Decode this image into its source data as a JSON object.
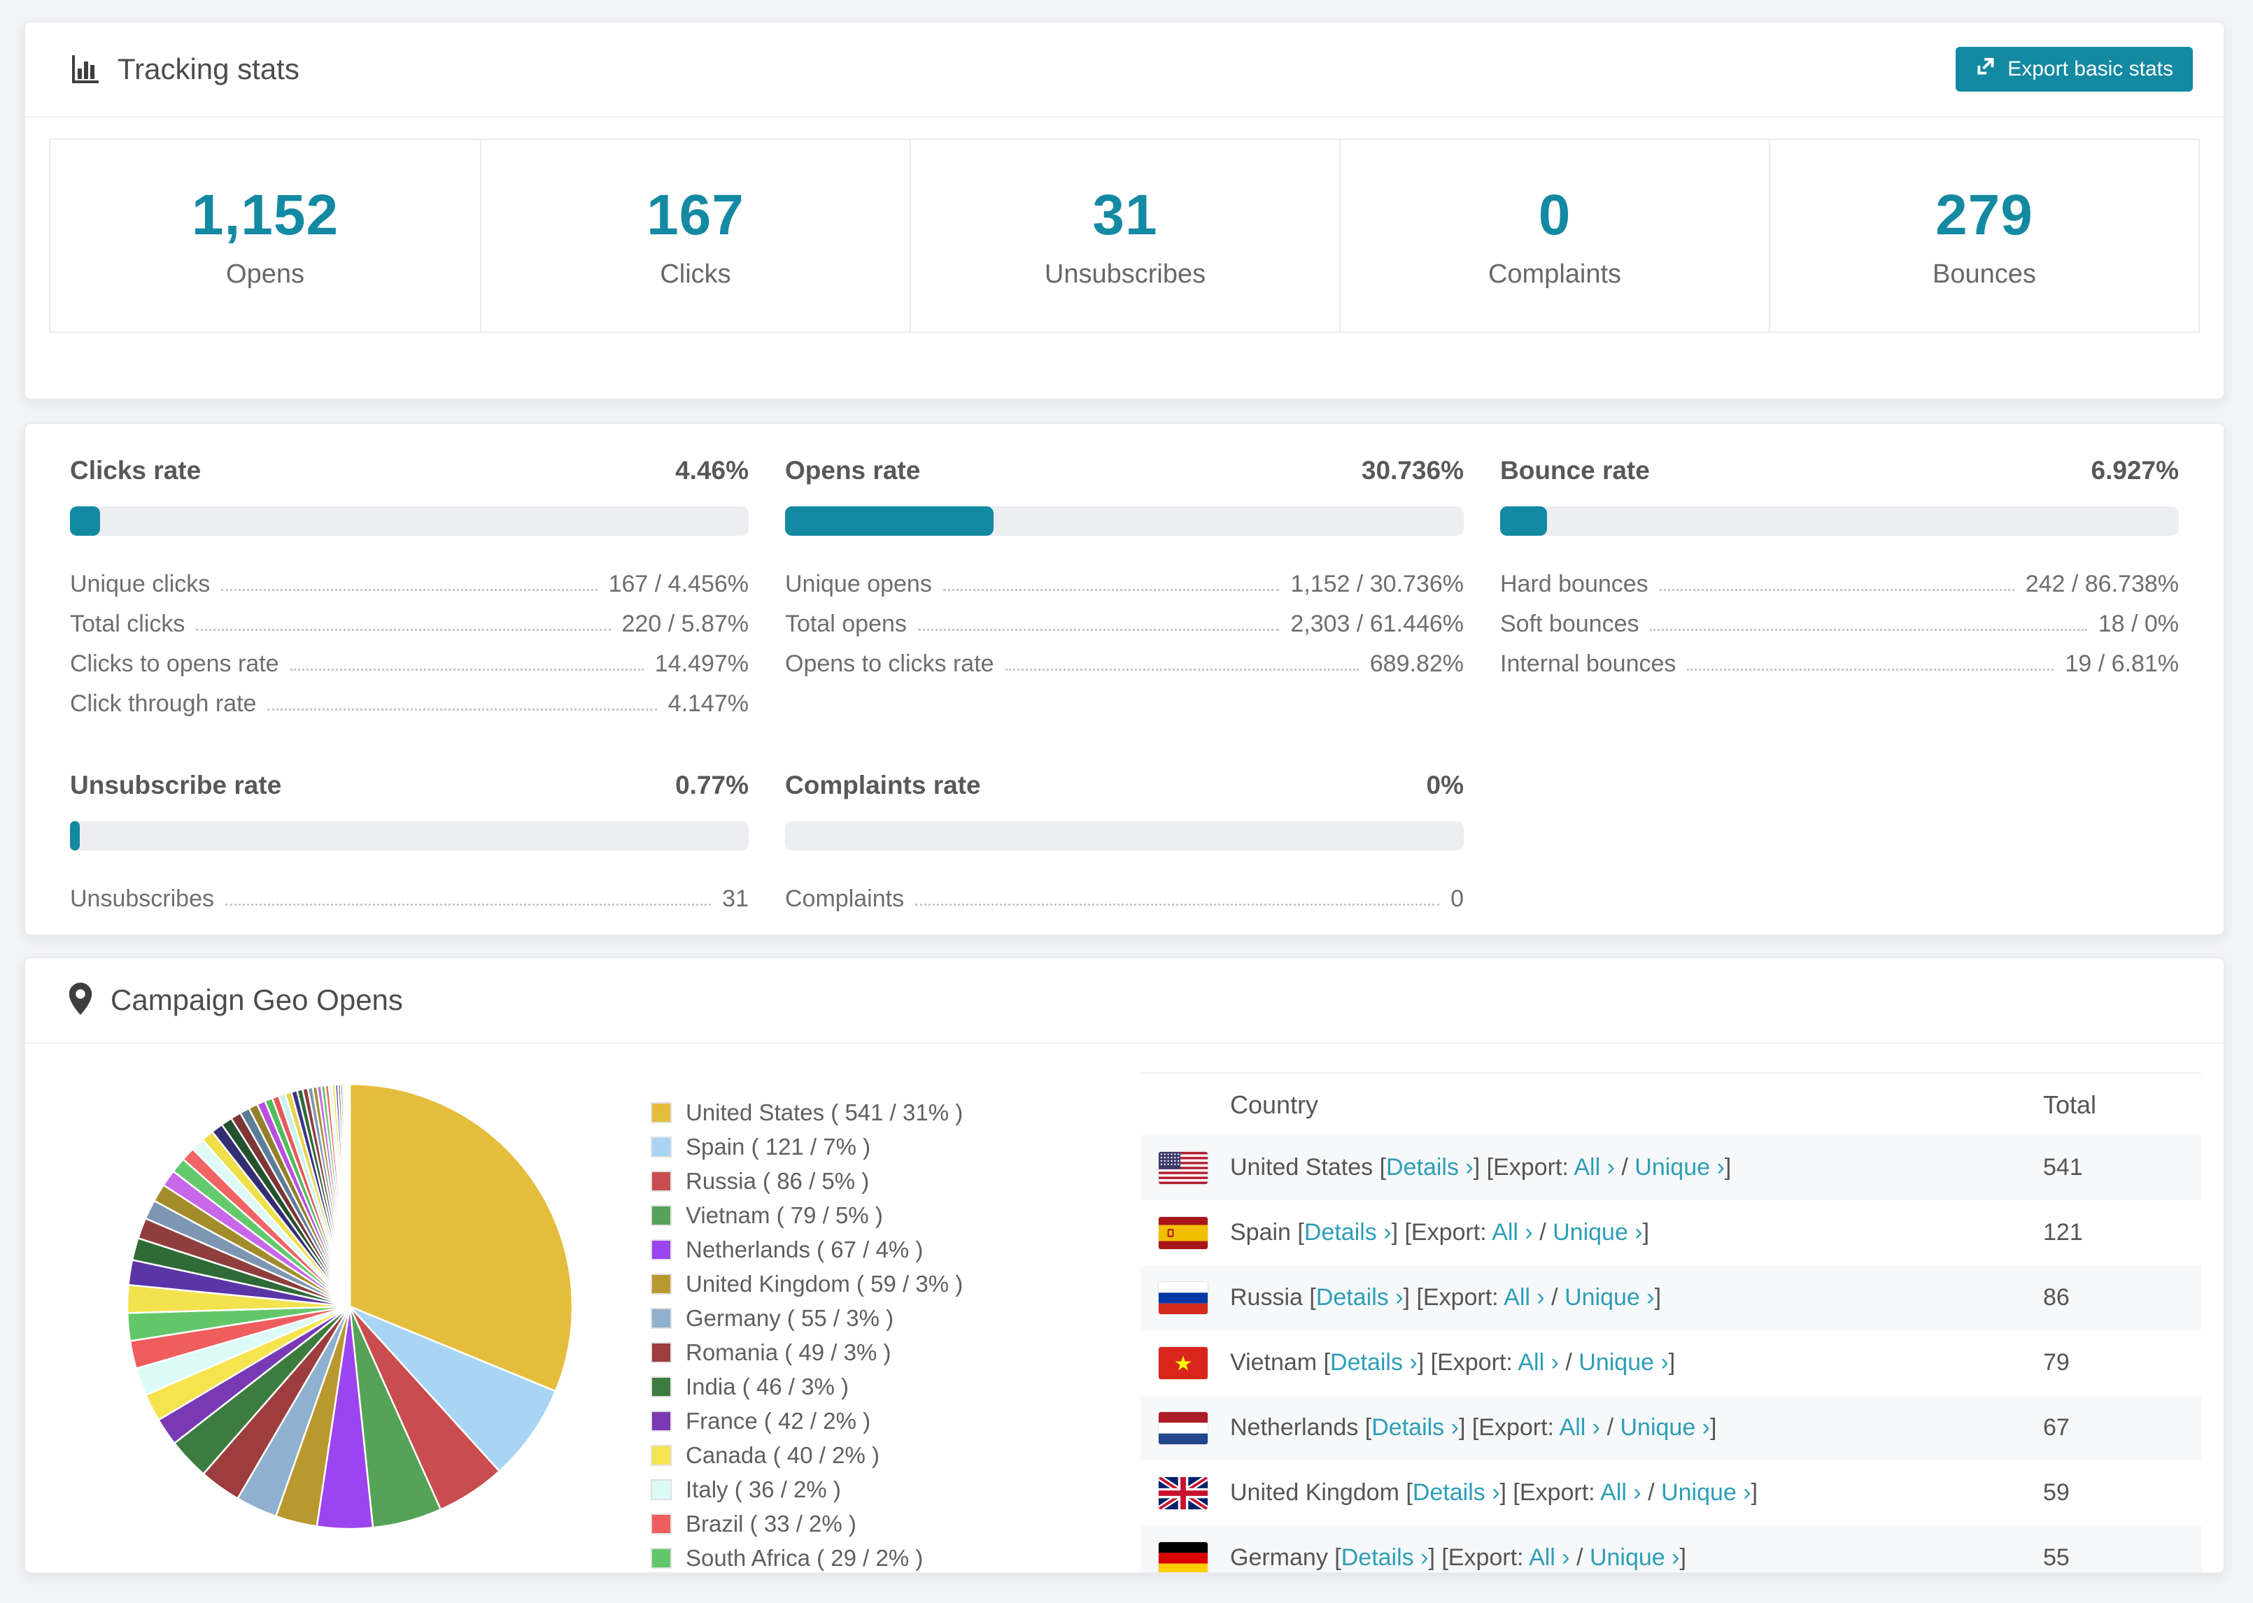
{
  "accent": "#1389a2",
  "link_color": "#2d9eb8",
  "tracking": {
    "title": "Tracking stats",
    "export_button": "Export basic stats",
    "stats": [
      {
        "value": "1,152",
        "label": "Opens"
      },
      {
        "value": "167",
        "label": "Clicks"
      },
      {
        "value": "31",
        "label": "Unsubscribes"
      },
      {
        "value": "0",
        "label": "Complaints"
      },
      {
        "value": "279",
        "label": "Bounces"
      }
    ]
  },
  "rates": [
    {
      "title": "Clicks rate",
      "value": "4.46%",
      "percent": 4.46,
      "metrics": [
        {
          "label": "Unique clicks",
          "value": "167 / 4.456%"
        },
        {
          "label": "Total clicks",
          "value": "220 / 5.87%"
        },
        {
          "label": "Clicks to opens rate",
          "value": "14.497%"
        },
        {
          "label": "Click through rate",
          "value": "4.147%"
        }
      ]
    },
    {
      "title": "Opens rate",
      "value": "30.736%",
      "percent": 30.736,
      "metrics": [
        {
          "label": "Unique opens",
          "value": "1,152 / 30.736%"
        },
        {
          "label": "Total opens",
          "value": "2,303 / 61.446%"
        },
        {
          "label": "Opens to clicks rate",
          "value": "689.82%"
        }
      ]
    },
    {
      "title": "Bounce rate",
      "value": "6.927%",
      "percent": 6.927,
      "metrics": [
        {
          "label": "Hard bounces",
          "value": "242 / 86.738%"
        },
        {
          "label": "Soft bounces",
          "value": "18 / 0%"
        },
        {
          "label": "Internal bounces",
          "value": "19 / 6.81%"
        }
      ]
    },
    {
      "title": "Unsubscribe rate",
      "value": "0.77%",
      "percent": 0.77,
      "metrics": [
        {
          "label": "Unsubscribes",
          "value": "31"
        }
      ]
    },
    {
      "title": "Complaints rate",
      "value": "0%",
      "percent": 0,
      "metrics": [
        {
          "label": "Complaints",
          "value": "0"
        }
      ]
    }
  ],
  "geo": {
    "title": "Campaign Geo Opens",
    "table": {
      "country_header": "Country",
      "total_header": "Total",
      "link_details": "Details",
      "export_prefix": "Export:",
      "link_all": "All",
      "link_unique": "Unique",
      "rows": [
        {
          "country": "United States",
          "flag": "us",
          "total": "541"
        },
        {
          "country": "Spain",
          "flag": "es",
          "total": "121"
        },
        {
          "country": "Russia",
          "flag": "ru",
          "total": "86"
        },
        {
          "country": "Vietnam",
          "flag": "vn",
          "total": "79"
        },
        {
          "country": "Netherlands",
          "flag": "nl",
          "total": "67"
        },
        {
          "country": "United Kingdom",
          "flag": "gb",
          "total": "59"
        },
        {
          "country": "Germany",
          "flag": "de",
          "total": "55"
        }
      ]
    }
  },
  "chart_data": {
    "type": "pie",
    "title": "Campaign Geo Opens",
    "legend_position": "right",
    "start_angle_deg": -90,
    "series": [
      {
        "name": "United States",
        "count": 541,
        "percent": 31,
        "color": "#e5bd3c"
      },
      {
        "name": "Spain",
        "count": 121,
        "percent": 7,
        "color": "#a9d5f5"
      },
      {
        "name": "Russia",
        "count": 86,
        "percent": 5,
        "color": "#c94c4e"
      },
      {
        "name": "Vietnam",
        "count": 79,
        "percent": 5,
        "color": "#55a357"
      },
      {
        "name": "Netherlands",
        "count": 67,
        "percent": 4,
        "color": "#9b44ef"
      },
      {
        "name": "United Kingdom",
        "count": 59,
        "percent": 3,
        "color": "#b9982f"
      },
      {
        "name": "Germany",
        "count": 55,
        "percent": 3,
        "color": "#8fb0ce"
      },
      {
        "name": "Romania",
        "count": 49,
        "percent": 3,
        "color": "#9d3d3d"
      },
      {
        "name": "India",
        "count": 46,
        "percent": 3,
        "color": "#3c7d3f"
      },
      {
        "name": "France",
        "count": 42,
        "percent": 2,
        "color": "#7939b5"
      },
      {
        "name": "Canada",
        "count": 40,
        "percent": 2,
        "color": "#f6e44e"
      },
      {
        "name": "Italy",
        "count": 36,
        "percent": 2,
        "color": "#dcfbf7"
      },
      {
        "name": "Brazil",
        "count": 33,
        "percent": 2,
        "color": "#ef5d5d"
      },
      {
        "name": "South Africa",
        "count": 29,
        "percent": 2,
        "color": "#63c76a"
      }
    ],
    "other_slices": {
      "percents": [
        2.0,
        1.8,
        1.6,
        1.5,
        1.4,
        1.3,
        1.2,
        1.1,
        1.0,
        0.95,
        0.9,
        0.85,
        0.8,
        0.75,
        0.7,
        0.65,
        0.6,
        0.55,
        0.5,
        0.48,
        0.45,
        0.42,
        0.4,
        0.38,
        0.35,
        0.32,
        0.3,
        0.28,
        0.26,
        0.24,
        0.22,
        0.2,
        0.18,
        0.16,
        0.14,
        0.12,
        0.1,
        0.08,
        0.06
      ],
      "colors": [
        "#f2e24e",
        "#5a35a8",
        "#2f6b36",
        "#8f3e3e",
        "#7d97b2",
        "#a38c2c",
        "#c868e8",
        "#63c96d",
        "#f06464",
        "#dff9f6",
        "#efe04a",
        "#332e72",
        "#24522c",
        "#7d3535",
        "#5c7d98",
        "#93802a",
        "#b94fe0",
        "#55bb60",
        "#e85858",
        "#c8f2ee",
        "#e8d44e",
        "#3c3488",
        "#2e6b36",
        "#8f3e3e",
        "#7d97b2",
        "#a38c2c",
        "#c868e8",
        "#63c96d",
        "#f06464",
        "#dff9f6",
        "#efe04a",
        "#5a35a8",
        "#2f6b36",
        "#8f3e3e",
        "#7d97b2",
        "#a38c2c",
        "#c868e8",
        "#63c96d",
        "#f06464"
      ]
    }
  }
}
